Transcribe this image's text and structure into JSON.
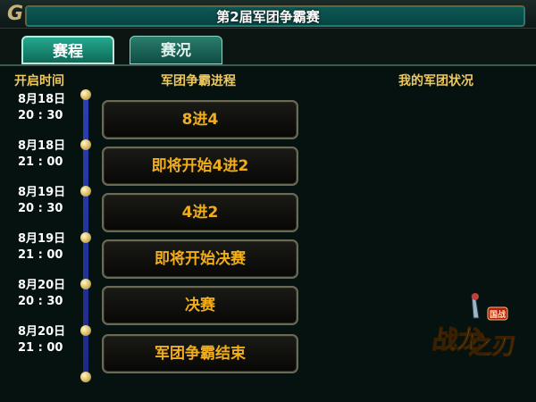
{
  "header": {
    "title": "第2届军团争霸赛"
  },
  "tabs": [
    {
      "label": "赛程",
      "active": true
    },
    {
      "label": "赛况",
      "active": false
    }
  ],
  "columns": {
    "time": "开启时间",
    "progress": "军团争霸进程",
    "status": "我的军团状况"
  },
  "schedule": [
    {
      "date": "8月18日",
      "time": "20 : 30",
      "stage": "8进4"
    },
    {
      "date": "8月18日",
      "time": "21 : 00",
      "stage": "即将开始4进2"
    },
    {
      "date": "8月19日",
      "time": "20 : 30",
      "stage": "4进2"
    },
    {
      "date": "8月19日",
      "time": "21 : 00",
      "stage": "即将开始决赛"
    },
    {
      "date": "8月20日",
      "time": "20 : 30",
      "stage": "决赛"
    },
    {
      "date": "8月20日",
      "time": "21 : 00",
      "stage": "军团争霸结束"
    }
  ],
  "logo": {
    "text": "战龙之刃",
    "badge": "国战"
  },
  "colors": {
    "accent_gold": "#f2ad1a",
    "header_gold": "#f1c95a",
    "tab_teal": "#24a88f",
    "timeline_blue": "#2b3fb1"
  },
  "icons": {
    "corner": "game-emblem-icon"
  }
}
